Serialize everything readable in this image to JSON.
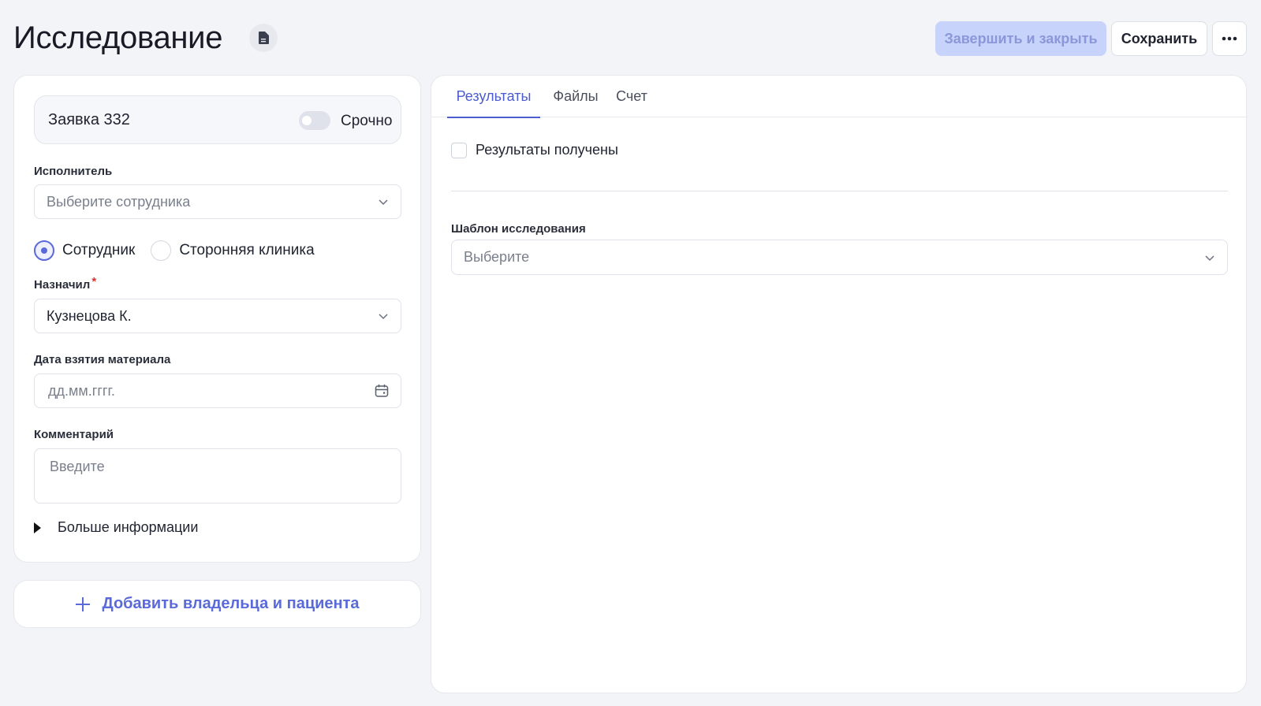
{
  "header": {
    "title": "Исследование",
    "doc_icon": "document-icon",
    "finish_label": "Завершить и закрыть",
    "save_label": "Сохранить",
    "more_icon": "more-horizontal-icon"
  },
  "request": {
    "title": "Заявка 332",
    "urgent_label": "Срочно",
    "urgent_on": false
  },
  "performer": {
    "label": "Исполнитель",
    "placeholder": "Выберите сотрудника"
  },
  "performer_type": {
    "options": [
      "Сотрудник",
      "Сторонняя клиника"
    ],
    "selected": "Сотрудник"
  },
  "assigned_by": {
    "label": "Назначил",
    "required_mark": "*",
    "value": "Кузнецова К."
  },
  "material_date": {
    "label": "Дата взятия материала",
    "placeholder": "дд.мм.гггг."
  },
  "comment": {
    "label": "Комментарий",
    "placeholder": "Введите"
  },
  "more_info": {
    "label": "Больше информации"
  },
  "add_owner": {
    "label": "Добавить владельца и пациента"
  },
  "tabs": [
    {
      "label": "Результаты",
      "active": true
    },
    {
      "label": "Файлы",
      "active": false
    },
    {
      "label": "Счет",
      "active": false
    }
  ],
  "results": {
    "received_label": "Результаты получены",
    "received_checked": false
  },
  "template": {
    "label": "Шаблон исследования",
    "placeholder": "Выберите"
  },
  "colors": {
    "accent": "#4b5bd0",
    "finish_bg": "#c7d3fb",
    "page_bg": "#f3f4f7"
  }
}
